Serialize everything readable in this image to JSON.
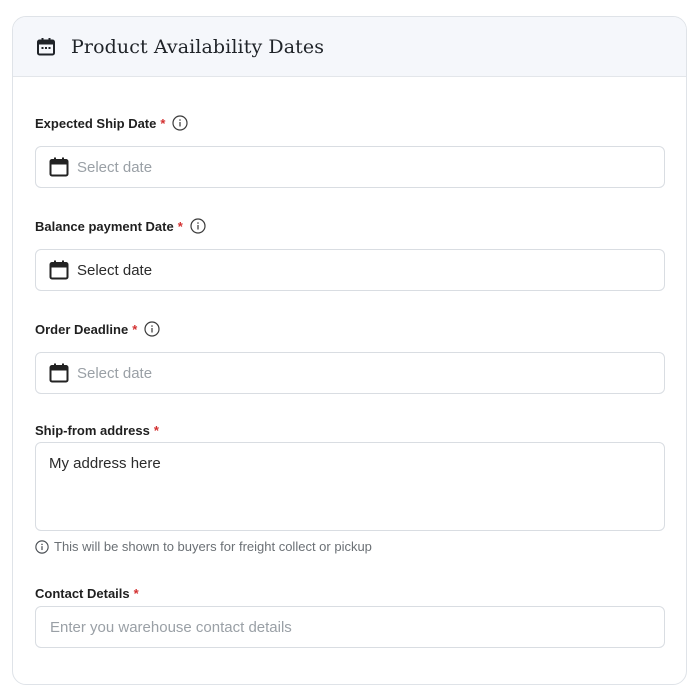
{
  "header": {
    "icon": "calendar-icon",
    "title": "Product Availability Dates"
  },
  "fields": {
    "expected_ship_date": {
      "label": "Expected Ship Date",
      "required_mark": "*",
      "placeholder": "Select date",
      "value": ""
    },
    "balance_payment_date": {
      "label": "Balance payment Date",
      "required_mark": "*",
      "placeholder": "Select date",
      "value": "Select date"
    },
    "order_deadline": {
      "label": "Order Deadline",
      "required_mark": "*",
      "placeholder": "Select date",
      "value": ""
    },
    "ship_from_address": {
      "label": "Ship-from address",
      "required_mark": "*",
      "value": "My address here",
      "hint": "This will be shown to buyers for freight collect or pickup"
    },
    "contact_details": {
      "label": "Contact Details",
      "required_mark": "*",
      "placeholder": "Enter you warehouse contact details",
      "value": ""
    }
  },
  "colors": {
    "required": "#d32f2f",
    "header_bg": "#f5f7fb",
    "border": "#d9dde2",
    "placeholder": "#9aa0a6"
  }
}
